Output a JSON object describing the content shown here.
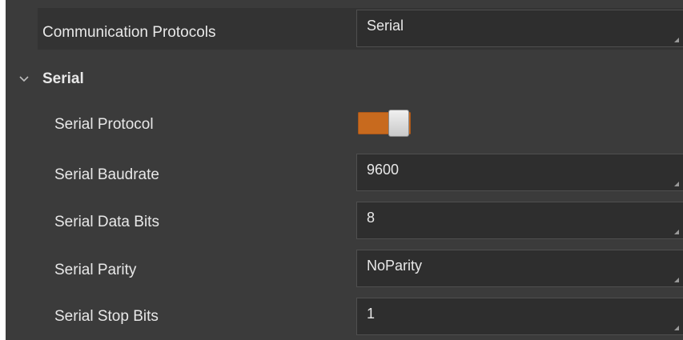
{
  "top": {
    "label": "Communication Protocols",
    "value": "Serial"
  },
  "group": {
    "title": "Serial",
    "expanded": true
  },
  "toggle": {
    "label": "Serial Protocol",
    "on": true,
    "color": "#c86a1e"
  },
  "fields": [
    {
      "label": "Serial Baudrate",
      "value": "9600"
    },
    {
      "label": "Serial Data Bits",
      "value": "8"
    },
    {
      "label": "Serial Parity",
      "value": "NoParity"
    },
    {
      "label": "Serial Stop Bits",
      "value": "1"
    }
  ],
  "icons": {
    "group_toggle": "chevron-down-icon",
    "resize": "resize-grip-icon"
  }
}
